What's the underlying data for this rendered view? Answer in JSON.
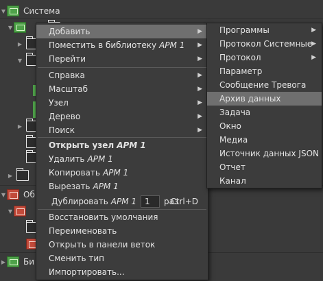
{
  "tree": {
    "root_label": "Система",
    "ob_label": "Об",
    "bi_label": "Би"
  },
  "context_menu": {
    "items": [
      {
        "label": "Добавить",
        "arg": "",
        "submenu": true,
        "highlighted": true
      },
      {
        "label": "Поместить в библиотеку",
        "arg": "АРМ 1",
        "submenu": true
      },
      {
        "label": "Перейти",
        "arg": "",
        "submenu": true
      },
      {
        "label": "Справка",
        "arg": "",
        "submenu": true
      },
      {
        "label": "Масштаб",
        "arg": "",
        "submenu": true
      },
      {
        "label": "Узел",
        "arg": "",
        "submenu": true
      },
      {
        "label": "Дерево",
        "arg": "",
        "submenu": true
      },
      {
        "label": "Поиск",
        "arg": "",
        "submenu": true
      },
      {
        "label": "Открыть узел",
        "arg": "АРМ 1",
        "bold": true
      },
      {
        "label": "Удалить",
        "arg": "АРМ 1"
      },
      {
        "label": "Копировать",
        "arg": "АРМ 1"
      },
      {
        "label": "Вырезать",
        "arg": "АРМ 1"
      },
      {
        "label": "Дублировать",
        "arg": "АРМ 1",
        "count": "1",
        "count_unit": "раз",
        "shortcut": "Ctrl+D"
      },
      {
        "label": "Восстановить умолчания",
        "arg": ""
      },
      {
        "label": "Переименовать",
        "arg": ""
      },
      {
        "label": "Открыть в панели веток",
        "arg": ""
      },
      {
        "label": "Сменить тип",
        "arg": ""
      },
      {
        "label": "Импортировать...",
        "arg": ""
      }
    ]
  },
  "submenu": {
    "items": [
      {
        "label": "Программы",
        "submenu": true
      },
      {
        "label": "Протокол Системные",
        "submenu": true
      },
      {
        "label": "Протокол",
        "submenu": true
      },
      {
        "label": "Параметр"
      },
      {
        "label": "Сообщение Тревога"
      },
      {
        "label": "Архив данных",
        "highlighted": true
      },
      {
        "label": "Задача"
      },
      {
        "label": "Окно"
      },
      {
        "label": "Медиа"
      },
      {
        "label": "Источник данных JSON"
      },
      {
        "label": "Отчет"
      },
      {
        "label": "Канал"
      }
    ]
  },
  "icons": {
    "submenu_arrow": "chevron-right-icon",
    "expand_arrow": "triangle-down-icon",
    "collapse_arrow": "triangle-right-icon"
  },
  "colors": {
    "background": "#3a3a3a",
    "menu_background": "#3c3c3c",
    "highlight": "#6f6f6f",
    "green_icon": "#4fa24a",
    "red_icon": "#c24a3a"
  }
}
